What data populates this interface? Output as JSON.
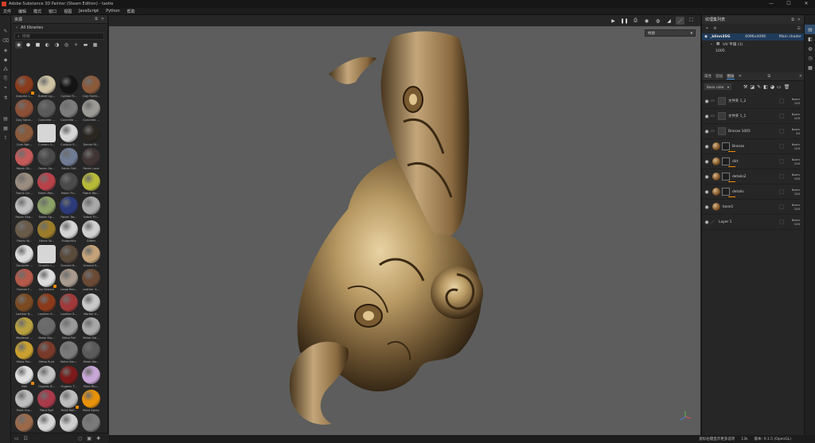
{
  "window": {
    "title": "Adobe Substance 3D Painter (Steam Edition) - taotie",
    "controls": [
      "—",
      "☐",
      "✕"
    ]
  },
  "menu": [
    "文件",
    "编辑",
    "模式",
    "窗口",
    "视图",
    "JavaScript",
    "Python",
    "帮助"
  ],
  "shelf": {
    "title": "资源",
    "library": "All libraries",
    "search_placeholder": "搜索",
    "materials": [
      {
        "label": "Autumn L...",
        "color": "#8a3b1c",
        "badge": true
      },
      {
        "label": "Baked Lig...",
        "color": "#cfc3a4"
      },
      {
        "label": "Carbon Fi...",
        "color": "#141414"
      },
      {
        "label": "Clay Earth...",
        "color": "#8a5a3a"
      },
      {
        "label": "Clay Sand...",
        "color": "#8c5036"
      },
      {
        "label": "Concrete ...",
        "color": "#5a5a5a"
      },
      {
        "label": "Concrete ...",
        "color": "#7c7c7c"
      },
      {
        "label": "Concrete ...",
        "color": "#9c9a94"
      },
      {
        "label": "Cork Nat...",
        "color": "#8a5a3a"
      },
      {
        "label": "Custom G...",
        "color": "#d6d6d6",
        "square": true
      },
      {
        "label": "Custom S...",
        "color": "#d6d6d6"
      },
      {
        "label": "Denim Ri...",
        "color": "#2a2620"
      },
      {
        "label": "Fabric Gli...",
        "color": "#c45a5a"
      },
      {
        "label": "Fabric Ge...",
        "color": "#4a4a4a"
      },
      {
        "label": "Fabric Felt",
        "color": "#6f7c94"
      },
      {
        "label": "Fabric Lace",
        "color": "#403434"
      },
      {
        "label": "Fabric Lin...",
        "color": "#9a8c80"
      },
      {
        "label": "Fabric Mel...",
        "color": "#b8424a"
      },
      {
        "label": "Fabric Pu...",
        "color": "#4a4a4a"
      },
      {
        "label": "Fabric Rip...",
        "color": "#b7ba38"
      },
      {
        "label": "Fabric Sha...",
        "color": "#bebebe"
      },
      {
        "label": "Fabric Sp...",
        "color": "#8aa067"
      },
      {
        "label": "Fabric Tar...",
        "color": "#2c3a7a"
      },
      {
        "label": "Fabric Tri...",
        "color": "#a8a8a8"
      },
      {
        "label": "Fabric W...",
        "color": "#6a5a48"
      },
      {
        "label": "Fabric W...",
        "color": "#9a7c2a"
      },
      {
        "label": "Footprints",
        "color": "#d4d4d4"
      },
      {
        "label": "Glitter",
        "color": "#cfcfcf"
      },
      {
        "label": "Gouache ...",
        "color": "#dcdcdc"
      },
      {
        "label": "Graphic L...",
        "color": "#d6d6d6",
        "square": true
      },
      {
        "label": "Ground H...",
        "color": "#5a4a3a"
      },
      {
        "label": "Ground S...",
        "color": "#c4a27a"
      },
      {
        "label": "Human F...",
        "color": "#b45a4a"
      },
      {
        "label": "Ivy Branch",
        "color": "#dcdcdc",
        "badge": true
      },
      {
        "label": "Large Ran...",
        "color": "#a89a8c"
      },
      {
        "label": "Leather G...",
        "color": "#6a4a34"
      },
      {
        "label": "Leather B...",
        "color": "#7a4a22"
      },
      {
        "label": "Leather S...",
        "color": "#8a3a1a"
      },
      {
        "label": "Leather S...",
        "color": "#a03a3a"
      },
      {
        "label": "Marble V...",
        "color": "#c8c8c8"
      },
      {
        "label": "Medieval ...",
        "color": "#b8a040"
      },
      {
        "label": "Metal Bro...",
        "color": "#6a6a6a"
      },
      {
        "label": "Metal Foil",
        "color": "#9a9a9a"
      },
      {
        "label": "Metal Gal...",
        "color": "#a8a8a8"
      },
      {
        "label": "Metal Pol...",
        "color": "#caa030"
      },
      {
        "label": "Metal Rust",
        "color": "#7a3a2a"
      },
      {
        "label": "Metal San...",
        "color": "#7a7a7a"
      },
      {
        "label": "Metal Wo...",
        "color": "#5a5a5a"
      },
      {
        "label": "Nail",
        "color": "#e0e0e0",
        "badge": true
      },
      {
        "label": "Organic B...",
        "color": "#c4c4c4"
      },
      {
        "label": "Organic T...",
        "color": "#7a1a1a"
      },
      {
        "label": "Paint Blu...",
        "color": "#c8a6d6"
      },
      {
        "label": "Paint Cra...",
        "color": "#bdbdbd"
      },
      {
        "label": "Paint Roll",
        "color": "#a83a4a"
      },
      {
        "label": "Paint Roll...",
        "color": "#bdbdbd",
        "badge": true
      },
      {
        "label": "Paint Spray",
        "color": "#e8920a"
      },
      {
        "label": "",
        "color": "#9a6a4a"
      },
      {
        "label": "",
        "color": "#d6d6d6"
      },
      {
        "label": "",
        "color": "#cfcfcf"
      },
      {
        "label": "",
        "color": "#7a7a7a"
      }
    ]
  },
  "viewport": {
    "mode_select": "材质"
  },
  "status": {
    "hint": "鼠标右键显示更多选项",
    "count": "13k",
    "version": "版本: 9.1.5 (OpenGL)"
  },
  "texture_set": {
    "title": "纹理集列表",
    "name": "_blinn3SG",
    "resolution": "4096x4096",
    "shader": "Main shader",
    "uv_label": "UV 平铺 (1)",
    "uv_tile": "1005"
  },
  "layers_panel": {
    "tabs": [
      "属性",
      "图层",
      "图层"
    ],
    "blend_mode": "Base color",
    "layers": [
      {
        "name": "文件夹 1_2",
        "type": "folder",
        "blend": "Norm",
        "opacity": "100"
      },
      {
        "name": "文件夹 1_1",
        "type": "folder",
        "blend": "Norm",
        "opacity": "100"
      },
      {
        "name": "Bronze 1005",
        "type": "folder",
        "blend": "Norm",
        "opacity": "40"
      },
      {
        "name": "Bronze",
        "type": "mat-mask",
        "blend": "Norm",
        "opacity": "100"
      },
      {
        "name": "dirt",
        "type": "mat-mask",
        "blend": "Norm",
        "opacity": "100"
      },
      {
        "name": "details2",
        "type": "mat-mask",
        "blend": "Norm",
        "opacity": "100"
      },
      {
        "name": "details",
        "type": "mat-mask",
        "blend": "Norm",
        "opacity": "100"
      },
      {
        "name": "base1",
        "type": "mat",
        "blend": "Norm",
        "opacity": "100"
      },
      {
        "name": "Layer 1",
        "type": "paint",
        "blend": "Norm",
        "opacity": "100"
      }
    ]
  },
  "colors": {
    "accent": "#3f8ee6",
    "selection": "#1f3b5a",
    "badge": "#f08a00",
    "viewport_bg": "#5d5d5d",
    "bronze": "#a98a5a"
  }
}
